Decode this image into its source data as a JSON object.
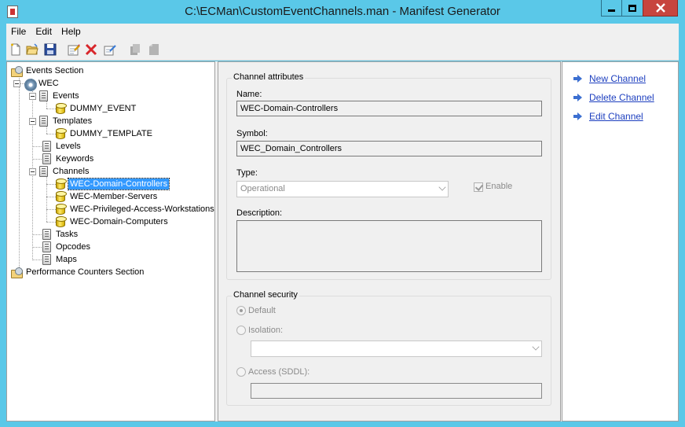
{
  "window": {
    "title": "C:\\ECMan\\CustomEventChannels.man - Manifest Generator"
  },
  "menu": {
    "file": "File",
    "edit": "Edit",
    "help": "Help"
  },
  "toolbar": {
    "icons": [
      "new-icon",
      "open-icon",
      "save-icon",
      "edit-properties-icon",
      "delete-icon",
      "rename-icon",
      "disabled-copy-icon",
      "disabled-paste-icon"
    ]
  },
  "tree": {
    "events_section": "Events Section",
    "wec": "WEC",
    "events": "Events",
    "dummy_event": "DUMMY_EVENT",
    "templates": "Templates",
    "dummy_template": "DUMMY_TEMPLATE",
    "levels": "Levels",
    "keywords": "Keywords",
    "channels": "Channels",
    "channel_items": [
      "WEC-Domain-Controllers",
      "WEC-Member-Servers",
      "WEC-Privileged-Access-Workstations",
      "WEC-Domain-Computers"
    ],
    "tasks": "Tasks",
    "opcodes": "Opcodes",
    "maps": "Maps",
    "perf_section": "Performance Counters Section"
  },
  "channel_attributes": {
    "group_label": "Channel attributes",
    "name_label": "Name:",
    "name_value": "WEC-Domain-Controllers",
    "symbol_label": "Symbol:",
    "symbol_value": "WEC_Domain_Controllers",
    "type_label": "Type:",
    "type_value": "Operational",
    "enable_label": "Enable",
    "description_label": "Description:",
    "description_value": ""
  },
  "channel_security": {
    "group_label": "Channel security",
    "default_label": "Default",
    "isolation_label": "Isolation:",
    "isolation_value": "",
    "access_label": "Access (SDDL):",
    "access_value": ""
  },
  "actions": {
    "new": "New Channel",
    "delete": "Delete Channel",
    "edit": "Edit Channel"
  }
}
